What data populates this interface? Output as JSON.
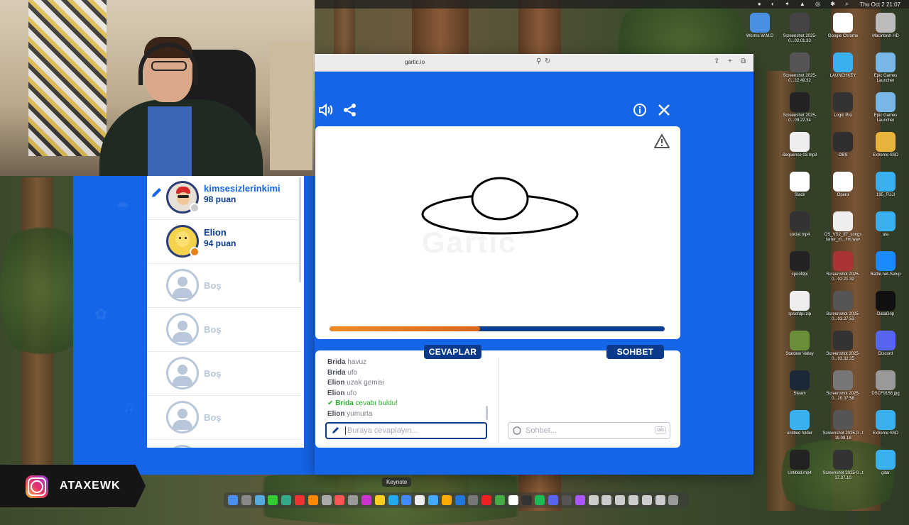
{
  "menubar": {
    "datetime": "Thu Oct 2  21:07"
  },
  "browser": {
    "url": "gartic.io"
  },
  "game": {
    "watermark": "Gartic",
    "progress_fraction": 0.45,
    "players": [
      {
        "name": "kimsesizlerinkimi",
        "score": "98 puan",
        "drawing": true
      },
      {
        "name": "Elion",
        "score": "94 puan",
        "drawing": false
      }
    ],
    "empty_slot_label": "Boş",
    "answers_tab": "CEVAPLAR",
    "chat_tab": "SOHBET",
    "answers": [
      {
        "user": "Brida",
        "text": "havuz",
        "correct": false
      },
      {
        "user": "Brida",
        "text": "ufo",
        "correct": false
      },
      {
        "user": "Elion",
        "text": "uzak gemisi",
        "correct": false
      },
      {
        "user": "Elion",
        "text": "ufo",
        "correct": false
      },
      {
        "user": "Brida",
        "text": "cevabı buldu!",
        "correct": true
      },
      {
        "user": "Elion",
        "text": "yumurta",
        "correct": false
      }
    ],
    "answer_placeholder": "Buraya cevaplayın...",
    "chat_placeholder": "Sohbet...",
    "chat_tab_hint": "tab"
  },
  "desktop": {
    "icons": [
      {
        "label": "Worms W.M.D",
        "color": "#4a90e2"
      },
      {
        "label": "Screenshot 2025-0...02.01.33",
        "color": "#444"
      },
      {
        "label": "Google Chrome",
        "color": "#fff"
      },
      {
        "label": "Macintosh HD",
        "color": "#bbb"
      },
      {
        "label": "Screenshot 2025-0...22.49.32",
        "color": "#555"
      },
      {
        "label": "LAUNCHKEY",
        "color": "#3ab0f0"
      },
      {
        "label": "Epic Games Launcher",
        "color": "#79b6e8"
      },
      {
        "label": "Screenshot 2025-0...09.22.34",
        "color": "#222"
      },
      {
        "label": "Logic Pro",
        "color": "#333"
      },
      {
        "label": "Epic Games Launcher",
        "color": "#79b6e8"
      },
      {
        "label": "Sequence 03.mp3",
        "color": "#eee"
      },
      {
        "label": "OBS",
        "color": "#302e31"
      },
      {
        "label": "Extreme SSD",
        "color": "#e8b33a"
      },
      {
        "label": "Slack",
        "color": "#fff"
      },
      {
        "label": "Opera",
        "color": "#fff"
      },
      {
        "label": "195_FUJI",
        "color": "#3ab0f0"
      },
      {
        "label": "social.mp4",
        "color": "#333"
      },
      {
        "label": "OS_VS2_87_songs tarter_m...#m.wav",
        "color": "#eee"
      },
      {
        "label": "ata",
        "color": "#3ab0f0"
      },
      {
        "label": "spoofdpi",
        "color": "#222"
      },
      {
        "label": "Screenshot 2025-0...02.21.32",
        "color": "#a33"
      },
      {
        "label": "Battle.net-Setup",
        "color": "#1a8cff"
      },
      {
        "label": "spoofdpi.zip",
        "color": "#eee"
      },
      {
        "label": "Screenshot 2025-0...03.27.53",
        "color": "#555"
      },
      {
        "label": "DataGrip",
        "color": "#111"
      },
      {
        "label": "Stardew Valley",
        "color": "#6b8e3a"
      },
      {
        "label": "Screenshot 2025-0...03.32.35",
        "color": "#333"
      },
      {
        "label": "Discord",
        "color": "#5865f2"
      },
      {
        "label": "Steam",
        "color": "#1b2838"
      },
      {
        "label": "Screenshot 2025-0...20.07.58",
        "color": "#777"
      },
      {
        "label": "DSCF9158.jpg",
        "color": "#999"
      },
      {
        "label": "untitled folder",
        "color": "#3ab0f0"
      },
      {
        "label": "Screenshot 2025-0...t 19.08.18",
        "color": "#555"
      },
      {
        "label": "Extreme SSD",
        "color": "#3ab0f0"
      },
      {
        "label": "Untitled.mp4",
        "color": "#222"
      },
      {
        "label": "Screenshot 2025-0...t 17.37.10",
        "color": "#333"
      },
      {
        "label": "gitar",
        "color": "#3ab0f0"
      }
    ]
  },
  "dock": {
    "tooltip": "Keynote"
  },
  "overlay": {
    "instagram_handle": "ATAXEWK"
  }
}
